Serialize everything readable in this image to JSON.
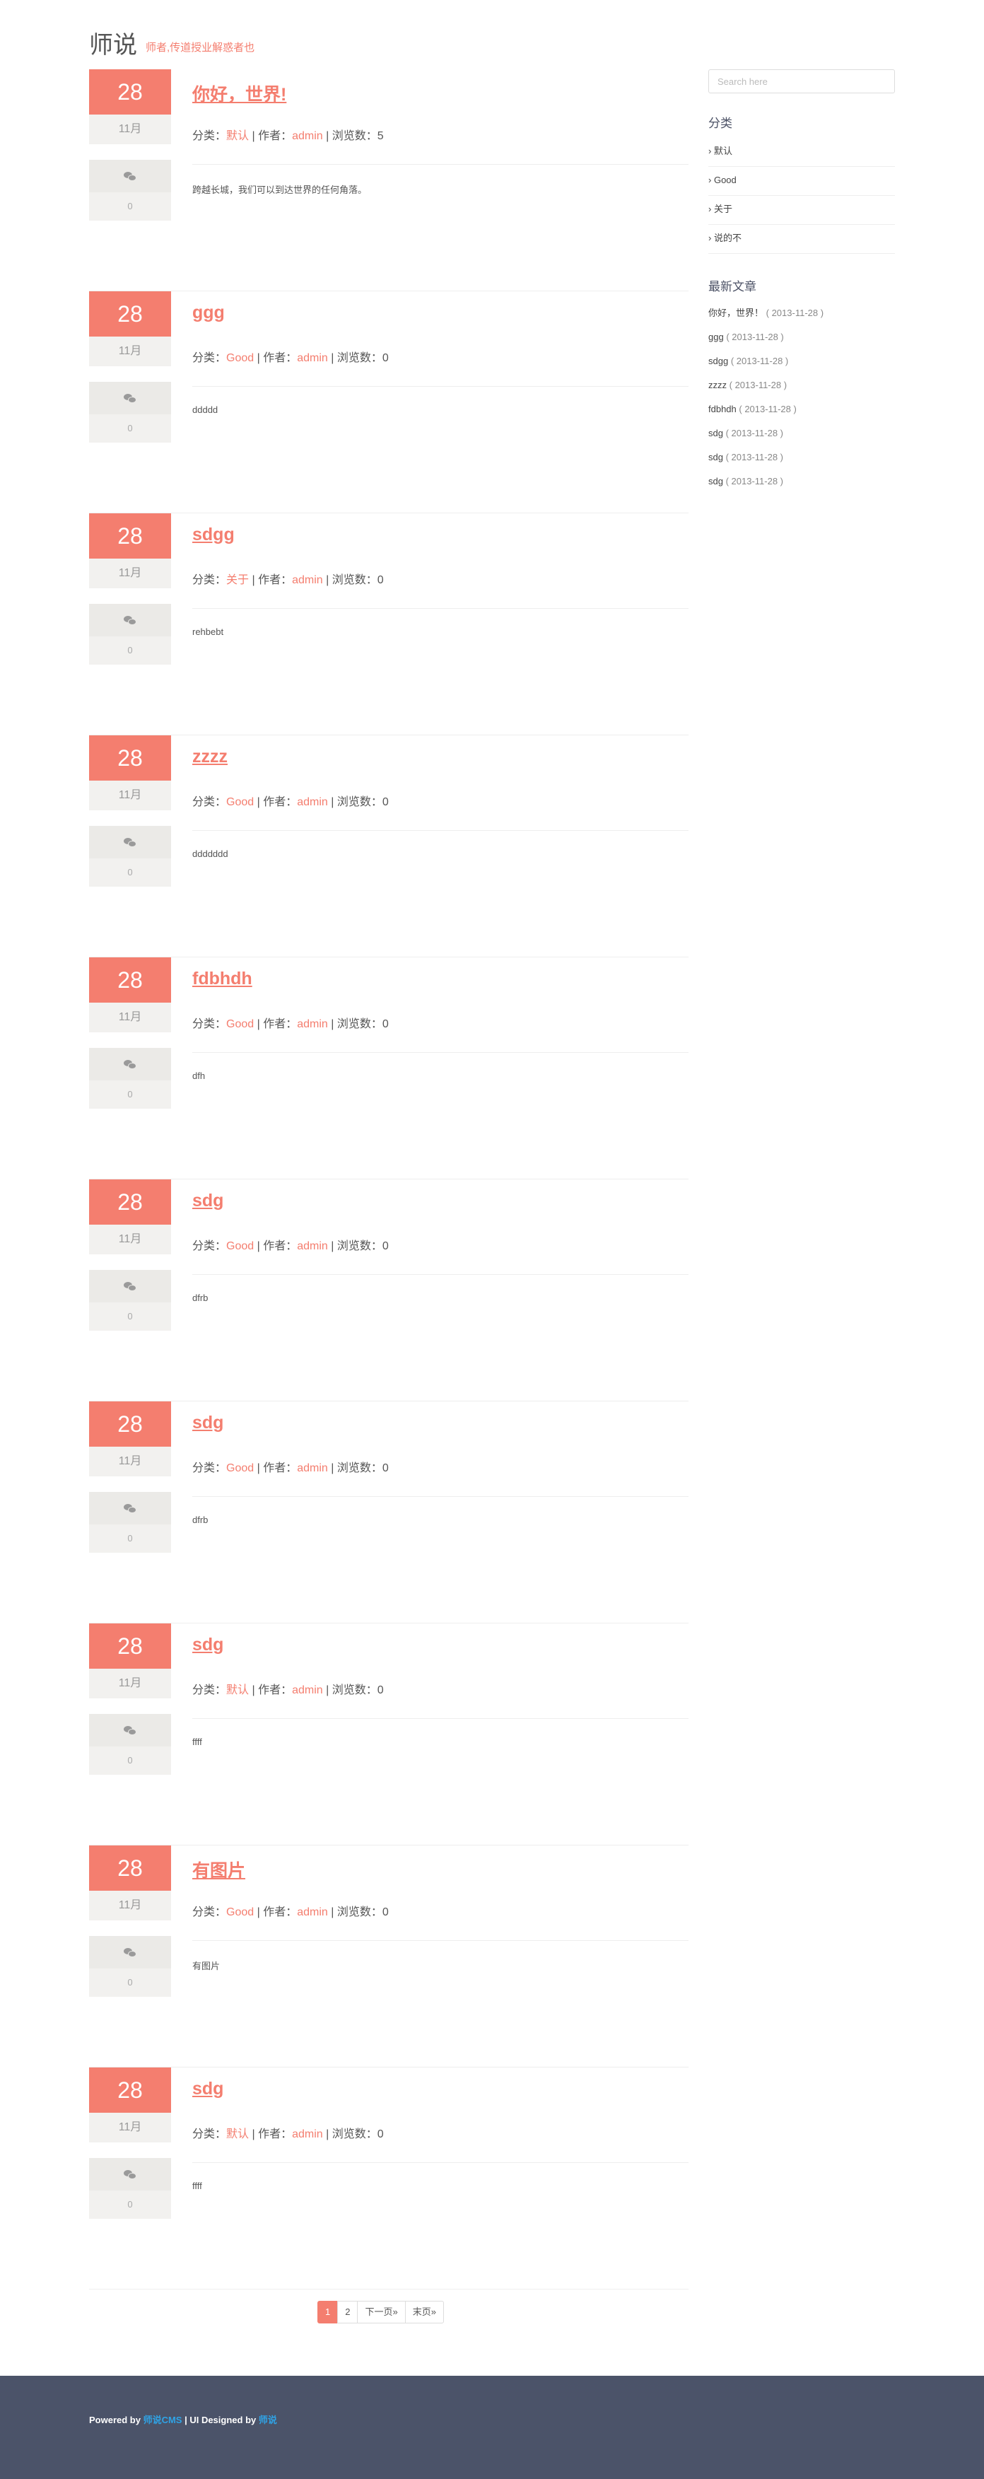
{
  "header": {
    "logo": "师说",
    "tagline": "师者,传道授业解惑者也"
  },
  "meta_labels": {
    "category": "分类：",
    "author": "作者：",
    "views": "浏览数："
  },
  "posts": [
    {
      "day": "28",
      "month": "11月",
      "comments": "0",
      "title": "你好，世界!",
      "category": "默认",
      "author": "admin",
      "views": "5",
      "excerpt": "跨越长城，我们可以到达世界的任何角落。"
    },
    {
      "day": "28",
      "month": "11月",
      "comments": "0",
      "title": "ggg",
      "category": "Good",
      "author": "admin",
      "views": "0",
      "excerpt": "ddddd"
    },
    {
      "day": "28",
      "month": "11月",
      "comments": "0",
      "title": "sdgg",
      "category": "关于",
      "author": "admin",
      "views": "0",
      "excerpt": "rehbebt"
    },
    {
      "day": "28",
      "month": "11月",
      "comments": "0",
      "title": "zzzz",
      "category": "Good",
      "author": "admin",
      "views": "0",
      "excerpt": "ddddddd"
    },
    {
      "day": "28",
      "month": "11月",
      "comments": "0",
      "title": "fdbhdh",
      "category": "Good",
      "author": "admin",
      "views": "0",
      "excerpt": "dfh"
    },
    {
      "day": "28",
      "month": "11月",
      "comments": "0",
      "title": "sdg",
      "category": "Good",
      "author": "admin",
      "views": "0",
      "excerpt": "dfrb"
    },
    {
      "day": "28",
      "month": "11月",
      "comments": "0",
      "title": "sdg",
      "category": "Good",
      "author": "admin",
      "views": "0",
      "excerpt": "dfrb"
    },
    {
      "day": "28",
      "month": "11月",
      "comments": "0",
      "title": "sdg",
      "category": "默认",
      "author": "admin",
      "views": "0",
      "excerpt": "ffff"
    },
    {
      "day": "28",
      "month": "11月",
      "comments": "0",
      "title": "有图片",
      "category": "Good",
      "author": "admin",
      "views": "0",
      "excerpt": "有图片"
    },
    {
      "day": "28",
      "month": "11月",
      "comments": "0",
      "title": "sdg",
      "category": "默认",
      "author": "admin",
      "views": "0",
      "excerpt": "ffff"
    }
  ],
  "pagination": {
    "pages": [
      "1",
      "2"
    ],
    "next": "下一页»",
    "last": "末页»"
  },
  "sidebar": {
    "search_placeholder": "Search here",
    "categories_title": "分类",
    "categories": [
      "默认",
      "Good",
      "关于",
      "说的不"
    ],
    "recent_title": "最新文章",
    "recent": [
      {
        "title": "你好，世界！",
        "date": "( 2013-11-28 )"
      },
      {
        "title": "ggg",
        "date": "( 2013-11-28 )"
      },
      {
        "title": "sdgg",
        "date": "( 2013-11-28 )"
      },
      {
        "title": "zzzz",
        "date": "( 2013-11-28 )"
      },
      {
        "title": "fdbhdh",
        "date": "( 2013-11-28 )"
      },
      {
        "title": "sdg",
        "date": "( 2013-11-28 )"
      },
      {
        "title": "sdg",
        "date": "( 2013-11-28 )"
      },
      {
        "title": "sdg",
        "date": "( 2013-11-28 )"
      }
    ]
  },
  "footer": {
    "powered": "Powered by ",
    "cms": "师说CMS",
    "designed": " | UI Designed by ",
    "designer": "师说"
  },
  "colors": {
    "accent": "#f47e6f",
    "footer_bg": "#4b5369",
    "link_blue": "#2fa4e7"
  }
}
